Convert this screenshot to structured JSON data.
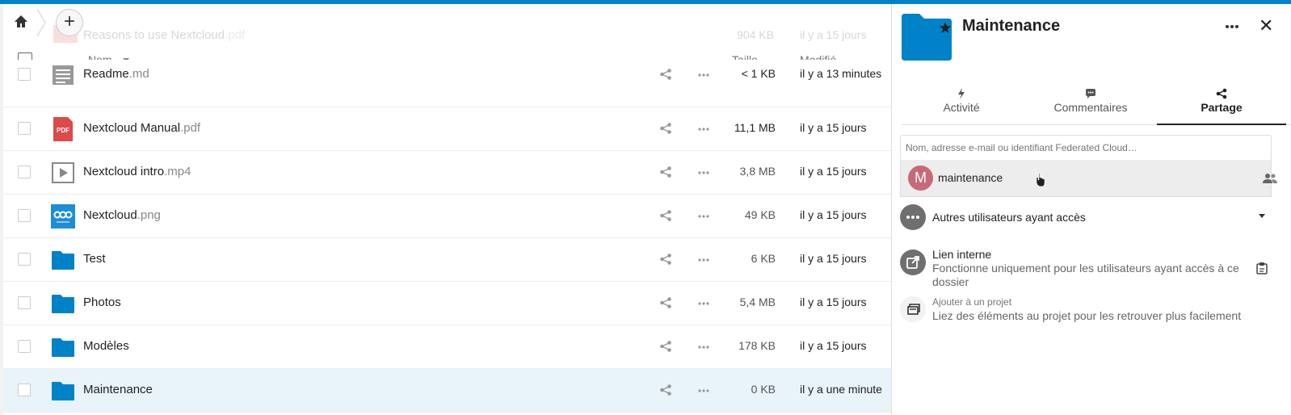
{
  "colors": {
    "accent": "#0082c9",
    "folder": "#0082c9",
    "selected_row": "#e8f3fa",
    "avatar": "#c7697b"
  },
  "ghost_row": {
    "name": "Reasons to use Nextcloud",
    "ext": ".pdf",
    "size": "904 KB",
    "modified": "il y a 15 jours"
  },
  "toolbar": {
    "home_icon": "home-icon",
    "new_label": "+"
  },
  "header": {
    "name": "Nom",
    "size": "Taille",
    "modified": "Modifié"
  },
  "files": [
    {
      "name": "Readme",
      "ext": ".md",
      "size": "< 1 KB",
      "modified": "il y a 13 minutes",
      "icon": "text-file-icon"
    },
    {
      "name": "Nextcloud Manual",
      "ext": ".pdf",
      "size": "11,1 MB",
      "modified": "il y a 15 jours",
      "icon": "pdf-icon",
      "icon_text": "PDF"
    },
    {
      "name": "Nextcloud intro",
      "ext": ".mp4",
      "size": "3,8 MB",
      "modified": "il y a 15 jours",
      "icon": "video-icon"
    },
    {
      "name": "Nextcloud",
      "ext": ".png",
      "size": "49 KB",
      "modified": "il y a 15 jours",
      "icon": "image-icon"
    },
    {
      "name": "Test",
      "ext": "",
      "size": "6 KB",
      "modified": "il y a 15 jours",
      "icon": "folder-icon"
    },
    {
      "name": "Photos",
      "ext": "",
      "size": "5,4 MB",
      "modified": "il y a 15 jours",
      "icon": "folder-icon"
    },
    {
      "name": "Modèles",
      "ext": "",
      "size": "178 KB",
      "modified": "il y a 15 jours",
      "icon": "folder-icon"
    },
    {
      "name": "Maintenance",
      "ext": "",
      "size": "0 KB",
      "modified": "il y a une minute",
      "icon": "folder-icon"
    }
  ],
  "sidebar": {
    "title": "Maintenance",
    "close": "✕",
    "tabs": [
      {
        "label": "Activité",
        "icon": "activity-icon"
      },
      {
        "label": "Commentaires",
        "icon": "comment-icon"
      },
      {
        "label": "Partage",
        "icon": "share-icon"
      }
    ],
    "share_placeholder": "Nom, adresse e-mail ou identifiant Federated Cloud…",
    "suggestion": {
      "initial": "M",
      "name": "maintenance"
    },
    "others": "Autres utilisateurs ayant accès",
    "internal_link": {
      "title": "Lien interne",
      "desc": "Fonctionne uniquement pour les utilisateurs ayant accès à ce dossier"
    },
    "project": {
      "title": "Ajouter à un projet",
      "desc": "Liez des éléments au projet pour les retrouver plus facilement"
    }
  }
}
